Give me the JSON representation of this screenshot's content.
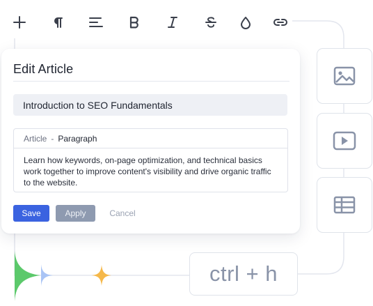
{
  "toolbar": {
    "items": [
      {
        "icon": "plus-icon"
      },
      {
        "icon": "pilcrow-icon"
      },
      {
        "icon": "align-left-icon"
      },
      {
        "icon": "bold-icon"
      },
      {
        "icon": "italic-icon"
      },
      {
        "icon": "strikethrough-icon"
      },
      {
        "icon": "color-drop-icon"
      },
      {
        "icon": "link-icon"
      }
    ]
  },
  "card": {
    "title": "Edit Article",
    "title_input_value": "Introduction to SEO Fundamentals",
    "breadcrumb": {
      "article": "Article",
      "separator": "-",
      "block": "Paragraph"
    },
    "body_text": "Learn how keywords, on-page optimization, and technical basics work together to improve content's visibility and drive organic traffic to the website.",
    "buttons": {
      "save": "Save",
      "apply": "Apply",
      "cancel": "Cancel"
    }
  },
  "side_tools": [
    {
      "icon": "image-icon"
    },
    {
      "icon": "video-icon"
    },
    {
      "icon": "table-icon"
    }
  ],
  "shortcut": {
    "label": "ctrl + h"
  },
  "colors": {
    "primary": "#3b63e0",
    "apply": "#8e9ab0",
    "icon": "#3a3f4b",
    "tile_icon": "#8993a8",
    "sparkle_green": "#5cc96b",
    "sparkle_blue": "#a9c4f5",
    "sparkle_orange": "#f5b84a"
  }
}
